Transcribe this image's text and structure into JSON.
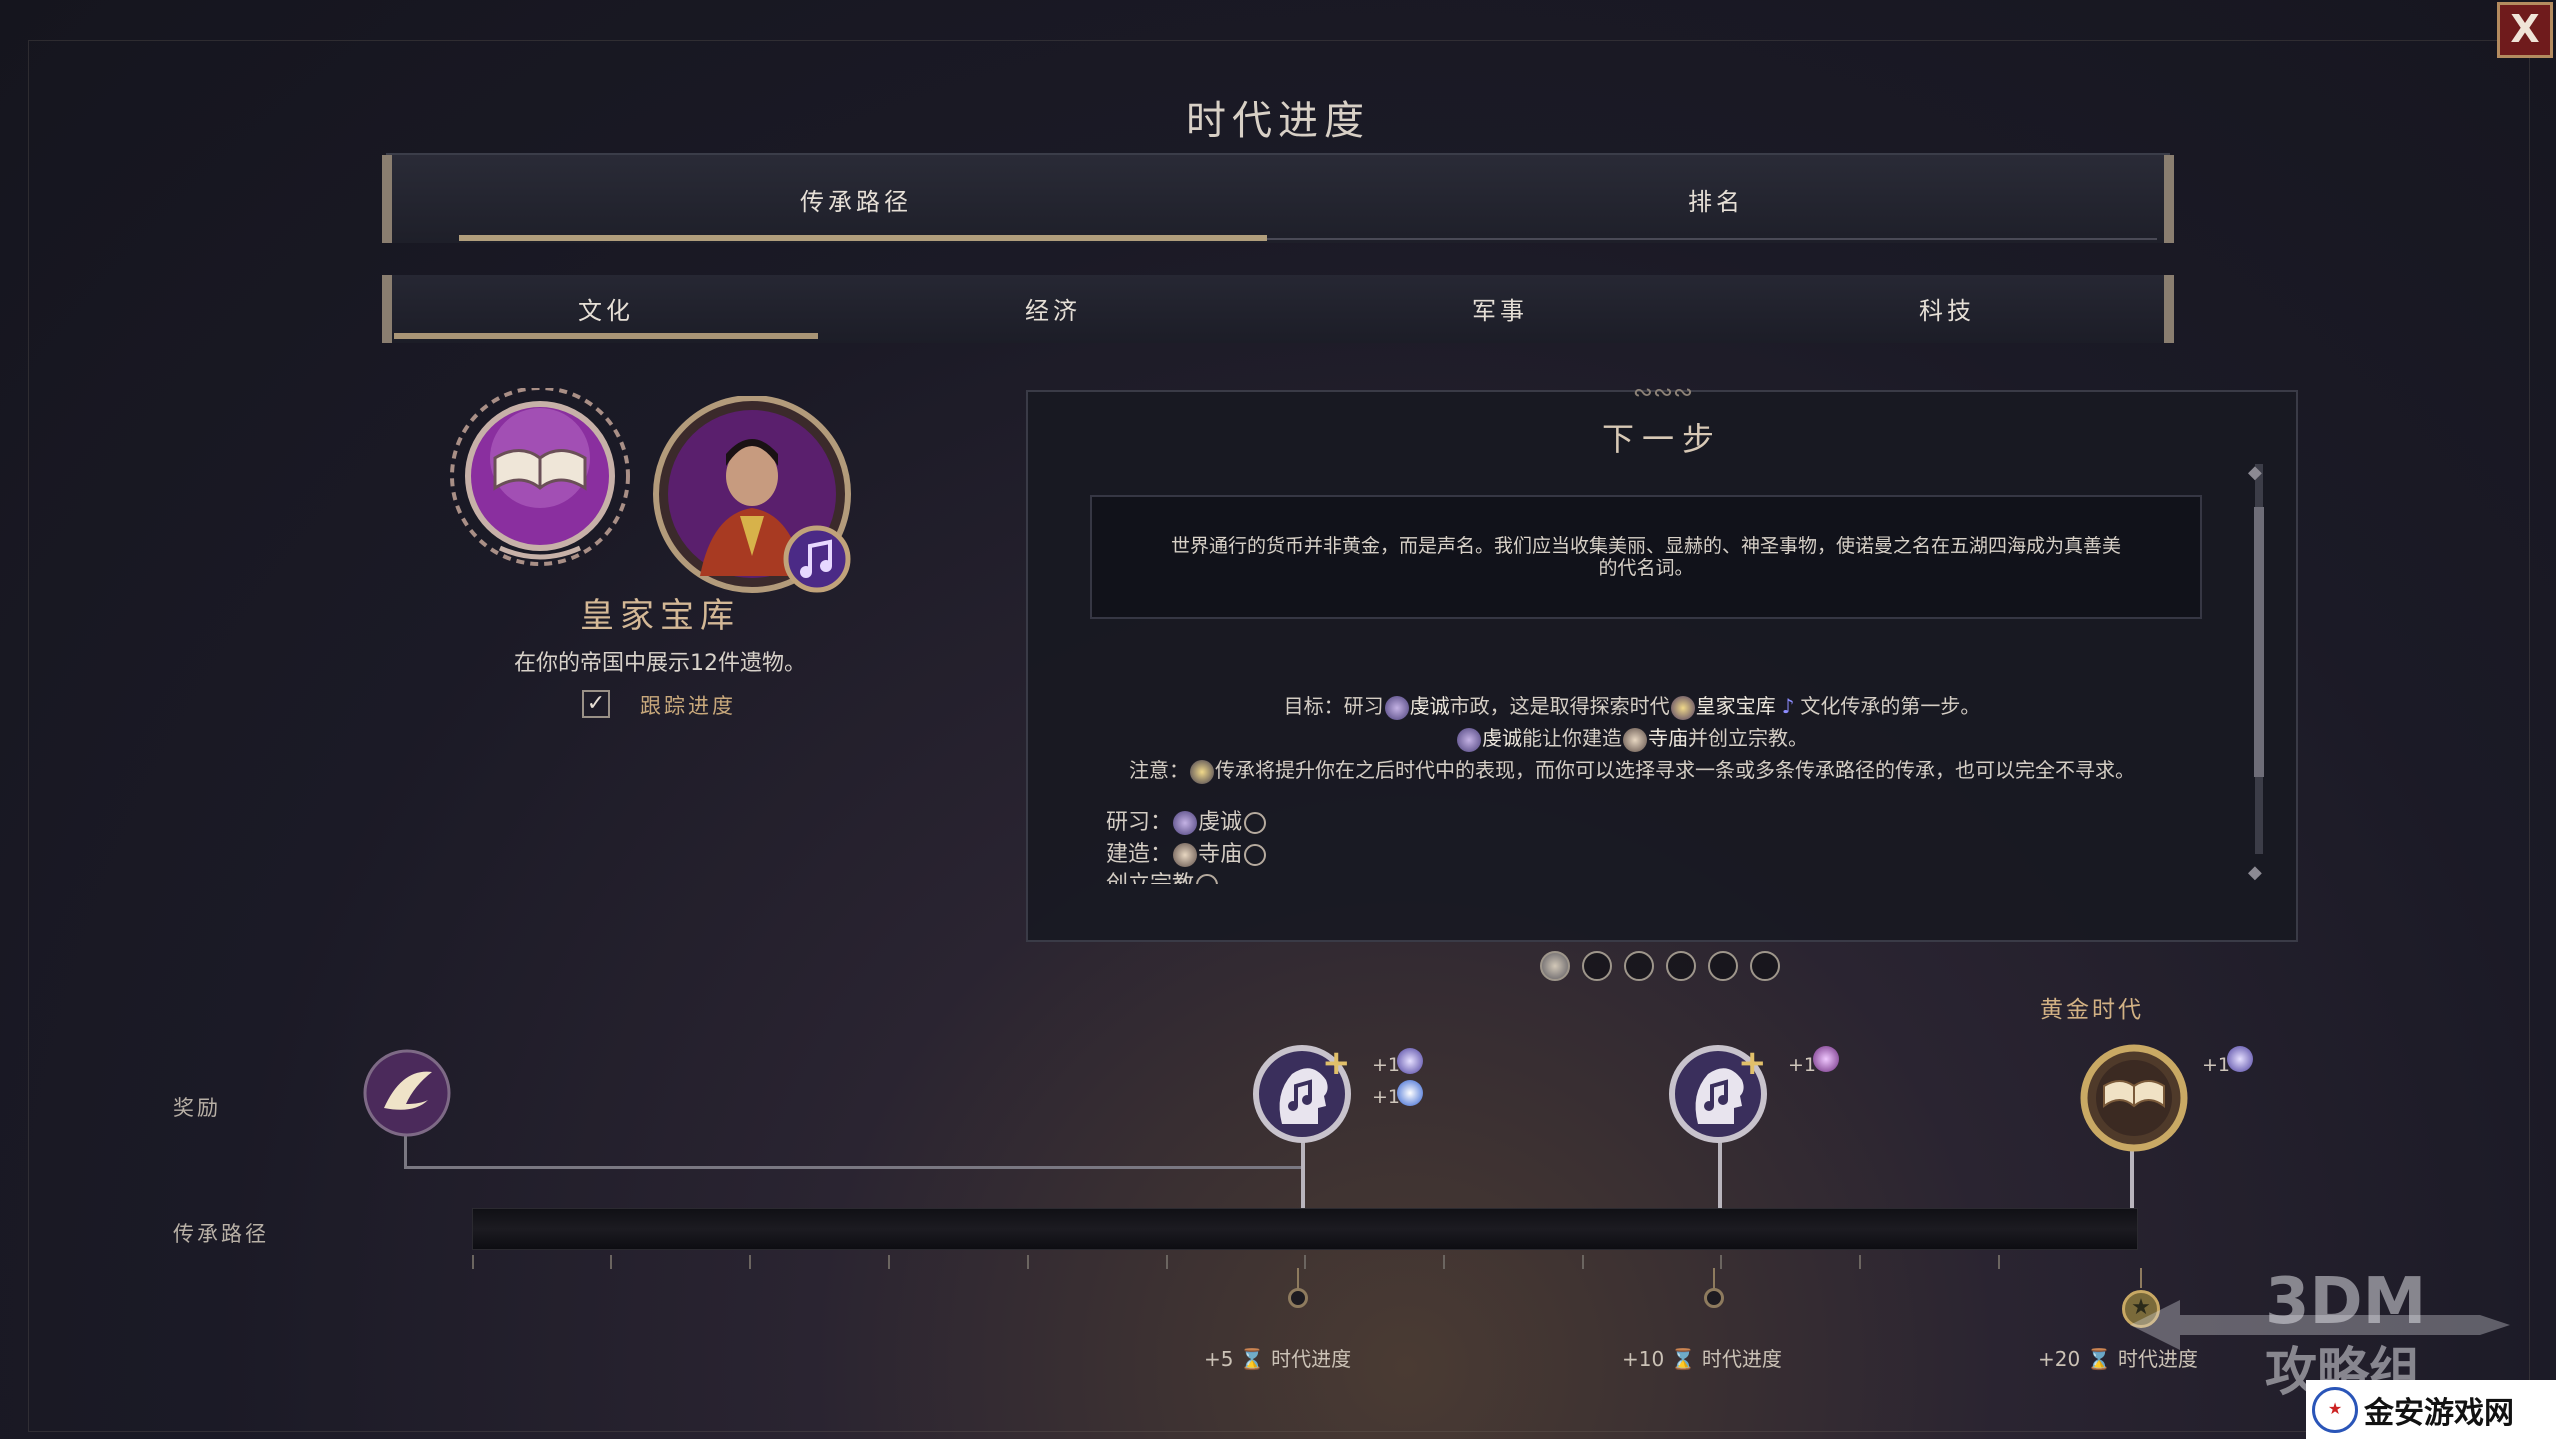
{
  "window": {
    "title": "时代进度",
    "close_label": "X"
  },
  "main_tabs": [
    {
      "label": "传承路径",
      "selected": true
    },
    {
      "label": "排名",
      "selected": false
    }
  ],
  "sub_tabs": [
    {
      "label": "文化",
      "selected": true
    },
    {
      "label": "经济",
      "selected": false
    },
    {
      "label": "军事",
      "selected": false
    },
    {
      "label": "科技",
      "selected": false
    }
  ],
  "legacy": {
    "name": "皇家宝库",
    "description": "在你的帝国中展示12件遗物。",
    "track_label": "跟踪进度",
    "track_checked": true
  },
  "next_step": {
    "title": "下一步",
    "quote_line1": "世界通行的货币并非黄金，而是声名。我们应当收集美丽、显赫的、神圣事物，使诺曼之名在五湖四海成为真善美",
    "quote_line2": "的代名词。",
    "goal": {
      "prefix": "目标：研习",
      "civic": "虔诚",
      "mid1": "市政，这是取得探索时代",
      "legacy": "皇家宝库",
      "suffix": "文化传承的第一步。"
    },
    "goal2": {
      "civic": "虔诚",
      "mid": "能让你建造",
      "building": "寺庙",
      "suffix": "并创立宗教。"
    },
    "note": "注意：",
    "note_text": "传承将提升你在之后时代中的表现，而你可以选择寻求一条或多条传承路径的传承，也可以完全不寻求。",
    "requirements": [
      {
        "label": "研习：",
        "item": "虔诚"
      },
      {
        "label": "建造：",
        "item": "寺庙"
      },
      {
        "label": "创立宗教",
        "item": ""
      }
    ],
    "pages_total": 6,
    "current_page": 1
  },
  "timeline": {
    "rewards_label": "奖励",
    "legacy_path_label": "传承路径",
    "golden_age_label": "黄金时代",
    "rewards": [
      {
        "plus": []
      },
      {
        "plus": [
          "+1",
          "+1"
        ]
      },
      {
        "plus": [
          "+1"
        ]
      },
      {
        "plus": [
          "+1"
        ]
      }
    ],
    "milestones": [
      {
        "points": "+5",
        "label": "时代进度"
      },
      {
        "points": "+10",
        "label": "时代进度"
      },
      {
        "points": "+20",
        "label": "时代进度"
      }
    ]
  },
  "watermark": {
    "brand": "3DM",
    "sub": "攻略组",
    "site": "金安游戏网"
  },
  "colors": {
    "accent": "#b19e7c",
    "gold": "#d2b184",
    "culture_purple": "#7a2f8f",
    "close_red": "#6f1b1c"
  }
}
